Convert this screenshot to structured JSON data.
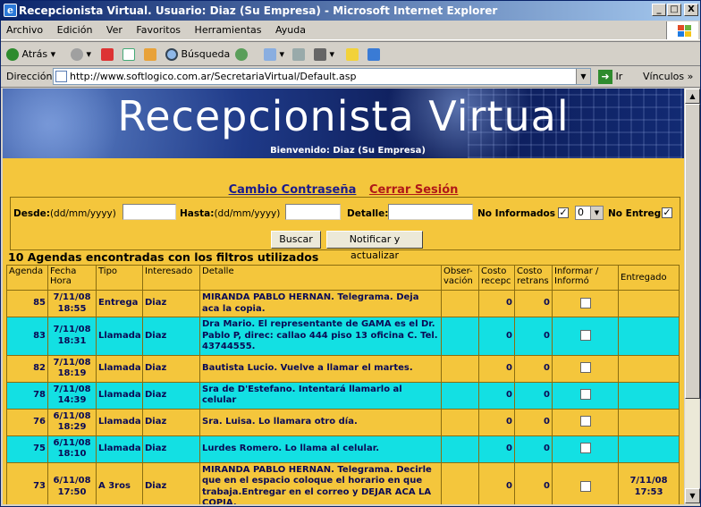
{
  "window": {
    "title": "Recepcionista Virtual. Usuario: Diaz (Su Empresa) - Microsoft Internet Explorer",
    "minimize": "_",
    "maximize": "□",
    "close": "X"
  },
  "menu": [
    "Archivo",
    "Edición",
    "Ver",
    "Favoritos",
    "Herramientas",
    "Ayuda"
  ],
  "toolbar": {
    "back_label": "Atrás",
    "search_label": "Búsqueda"
  },
  "address": {
    "label": "Dirección",
    "url": "http://www.softlogico.com.ar/SecretariaVirtual/Default.asp",
    "go_label": "Ir",
    "links_label": "Vínculos"
  },
  "banner": {
    "title": "Recepcionista Virtual",
    "welcome": "Bienvenido: Diaz (Su Empresa)"
  },
  "links": {
    "change_password": "Cambio Contraseña",
    "logout": "Cerrar Sesión"
  },
  "filters": {
    "desde_label": "Desde:",
    "desde_hint": "(dd/mm/yyyy)",
    "desde_value": "",
    "hasta_label": "Hasta:",
    "hasta_hint": "(dd/mm/yyyy)",
    "hasta_value": "",
    "detalle_label": "Detalle:",
    "detalle_value": "",
    "no_informados_label": "No Informados",
    "no_informados_checked": "✓",
    "select_value": "0",
    "no_entreg_label": "No Entreg",
    "no_entreg_checked": "✓",
    "search_button": "Buscar",
    "notify_button": "Notificar y actualizar"
  },
  "results_line": "10 Agendas encontradas con los filtros utilizados",
  "table": {
    "headers": {
      "agenda": "Agenda",
      "fecha": "Fecha Hora",
      "tipo": "Tipo",
      "interesado": "Interesado",
      "detalle": "Detalle",
      "observacion": "Obser-vación",
      "costo_recep": "Costo recepc",
      "costo_retrans": "Costo retrans",
      "informar": "Informar / Informó",
      "entregado": "Entregado"
    },
    "rows": [
      {
        "agenda": "85",
        "fecha": "7/11/08 18:55",
        "tipo": "Entrega",
        "interesado": "Diaz",
        "detalle": "MIRANDA PABLO HERNAN. Telegrama. Deja aca la copia.",
        "obs": "",
        "costo_recep": "0",
        "costo_retrans": "0",
        "entregado": ""
      },
      {
        "agenda": "83",
        "fecha": "7/11/08 18:31",
        "tipo": "Llamada",
        "interesado": "Diaz",
        "detalle": "Dra Mario. El representante de GAMA es el Dr. Pablo P, direc: callao 444 piso 13 oficina C. Tel. 43744555.",
        "obs": "",
        "costo_recep": "0",
        "costo_retrans": "0",
        "entregado": ""
      },
      {
        "agenda": "82",
        "fecha": "7/11/08 18:19",
        "tipo": "Llamada",
        "interesado": "Diaz",
        "detalle": "Bautista Lucio. Vuelve a llamar el martes.",
        "obs": "",
        "costo_recep": "0",
        "costo_retrans": "0",
        "entregado": ""
      },
      {
        "agenda": "78",
        "fecha": "7/11/08 14:39",
        "tipo": "Llamada",
        "interesado": "Diaz",
        "detalle": "Sra de D'Estefano. Intentará llamarlo al celular",
        "obs": "",
        "costo_recep": "0",
        "costo_retrans": "0",
        "entregado": ""
      },
      {
        "agenda": "76",
        "fecha": "6/11/08 18:29",
        "tipo": "Llamada",
        "interesado": "Diaz",
        "detalle": "Sra. Luisa. Lo llamara otro día.",
        "obs": "",
        "costo_recep": "0",
        "costo_retrans": "0",
        "entregado": ""
      },
      {
        "agenda": "75",
        "fecha": "6/11/08 18:10",
        "tipo": "Llamada",
        "interesado": "Diaz",
        "detalle": "Lurdes Romero. Lo llama al celular.",
        "obs": "",
        "costo_recep": "0",
        "costo_retrans": "0",
        "entregado": ""
      },
      {
        "agenda": "73",
        "fecha": "6/11/08 17:50",
        "tipo": "A 3ros",
        "interesado": "Diaz",
        "detalle": "MIRANDA PABLO HERNAN. Telegrama. Decirle que en el espacio coloque el horario en que trabaja.Entregar en el correo y DEJAR ACA LA COPIA.",
        "obs": "",
        "costo_recep": "0",
        "costo_retrans": "0",
        "entregado": "7/11/08 17:53"
      }
    ]
  }
}
